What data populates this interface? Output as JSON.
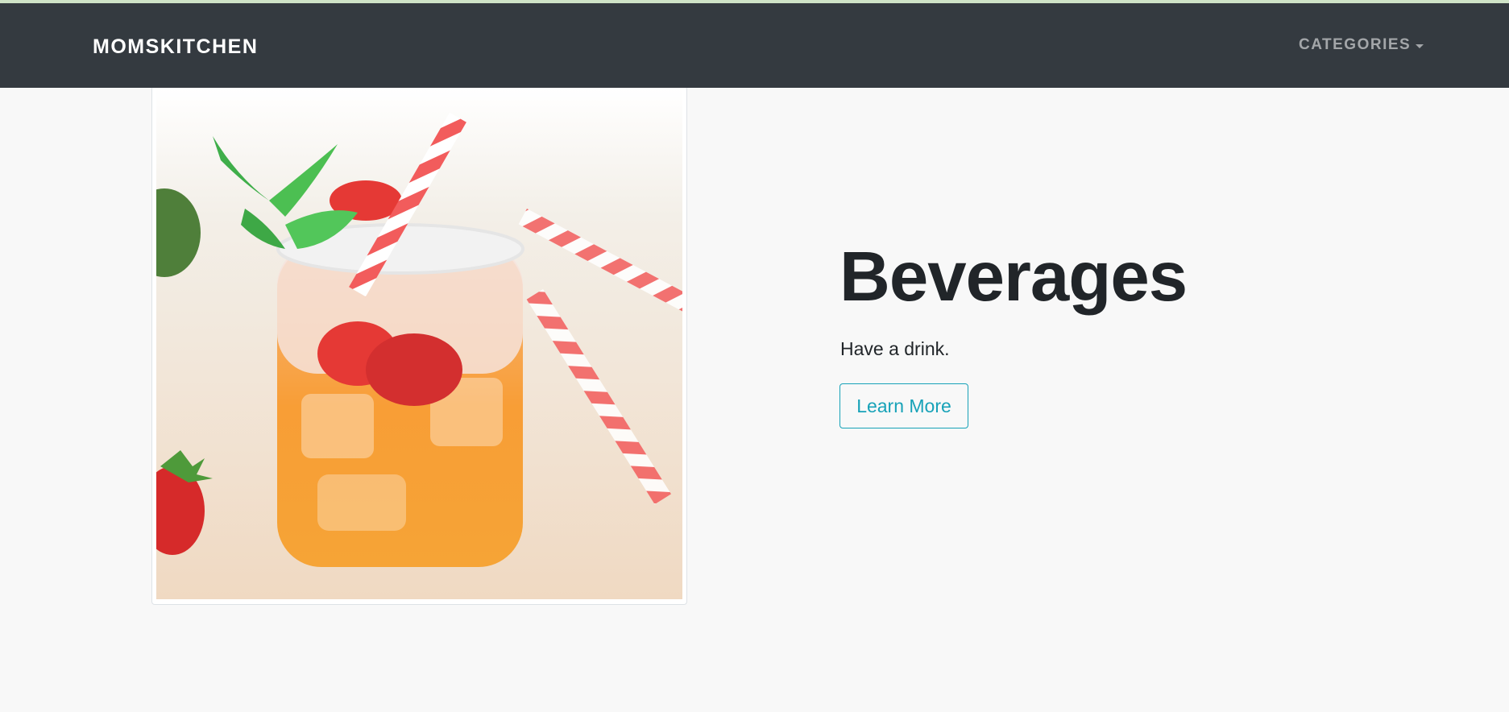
{
  "navbar": {
    "brand": "MOMSKITCHEN",
    "categories_label": "CATEGORIES",
    "categories_icon": "caret-down-icon"
  },
  "hero": {
    "image_subject": "iced drink in mason jar with strawberries, mint and red-striped straw",
    "title": "Beverages",
    "subtitle": "Have a drink.",
    "button_label": "Learn More"
  },
  "colors": {
    "navbar_bg": "#343a40",
    "page_bg": "#f8f8f8",
    "accent_info": "#17a2b8",
    "top_accent": "#cfe3c7"
  }
}
